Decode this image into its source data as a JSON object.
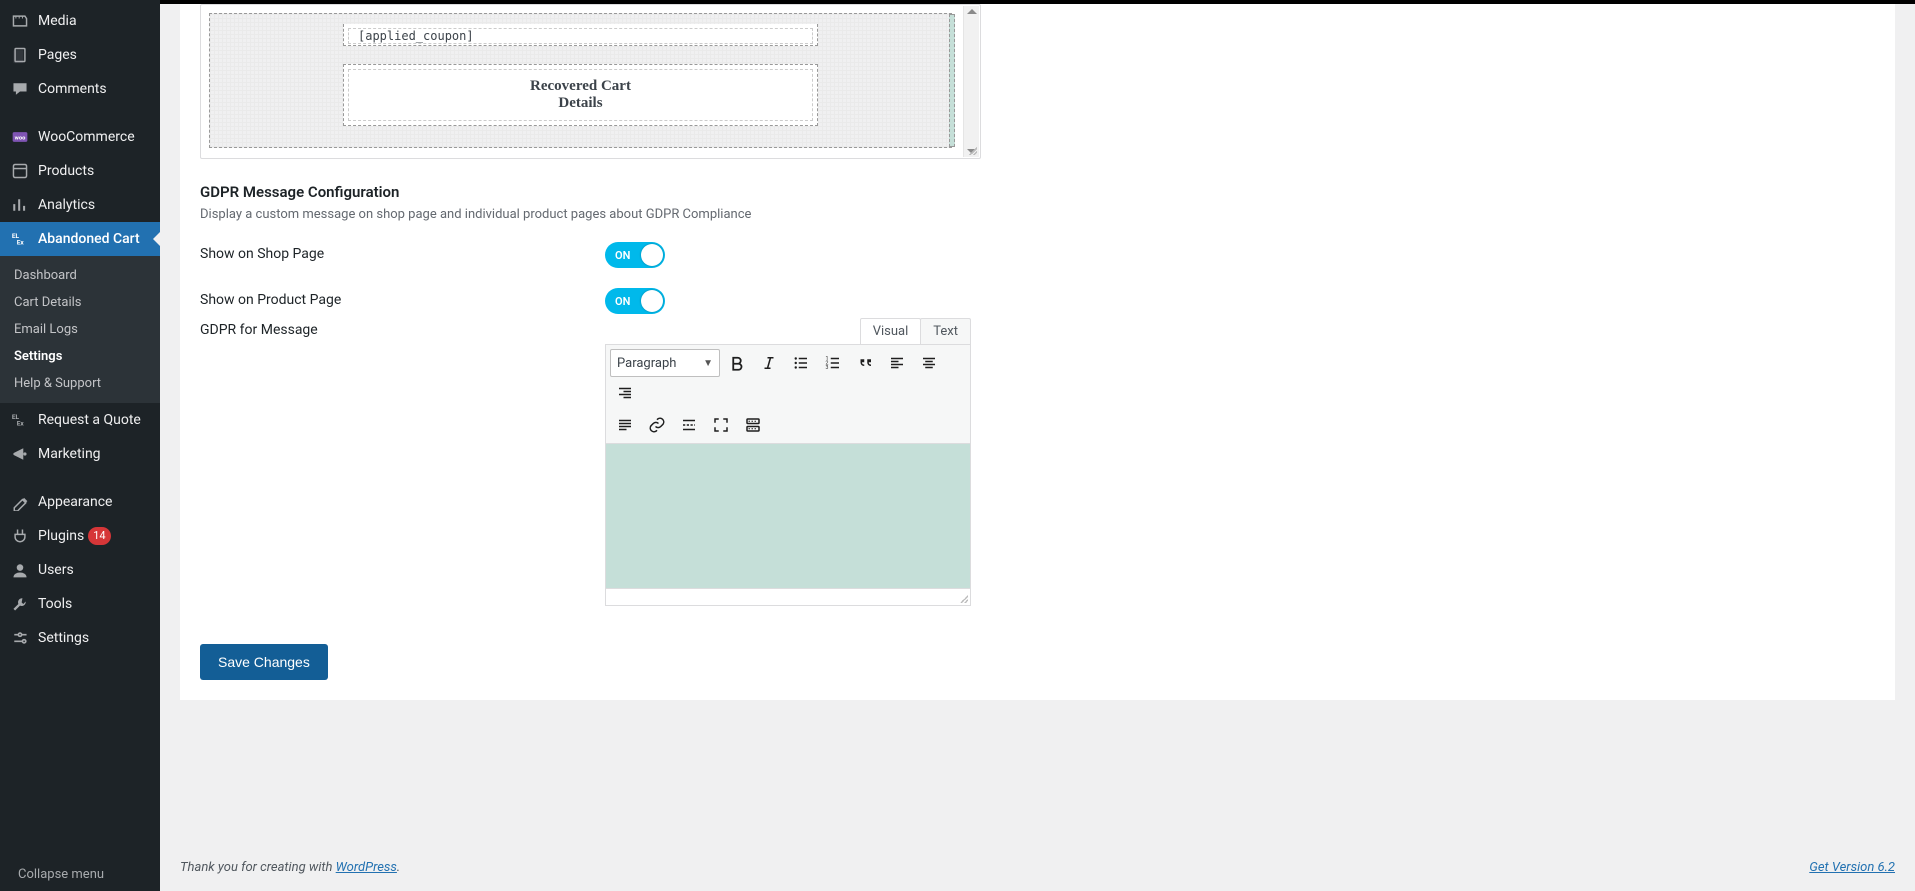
{
  "sidebar": {
    "items": [
      {
        "id": "media",
        "label": "Media",
        "icon": "media"
      },
      {
        "id": "pages",
        "label": "Pages",
        "icon": "pages"
      },
      {
        "id": "comments",
        "label": "Comments",
        "icon": "comments"
      },
      {
        "id": "sep",
        "separator": true
      },
      {
        "id": "woocommerce",
        "label": "WooCommerce",
        "icon": "woo"
      },
      {
        "id": "products",
        "label": "Products",
        "icon": "products"
      },
      {
        "id": "analytics",
        "label": "Analytics",
        "icon": "analytics"
      },
      {
        "id": "abandoned",
        "label": "Abandoned Cart",
        "icon": "elex",
        "active": true
      },
      {
        "id": "quote",
        "label": "Request a Quote",
        "icon": "elex"
      },
      {
        "id": "marketing",
        "label": "Marketing",
        "icon": "marketing"
      },
      {
        "id": "sep2",
        "separator": true
      },
      {
        "id": "appearance",
        "label": "Appearance",
        "icon": "appearance"
      },
      {
        "id": "plugins",
        "label": "Plugins",
        "icon": "plugins",
        "badge": "14"
      },
      {
        "id": "users",
        "label": "Users",
        "icon": "users"
      },
      {
        "id": "tools",
        "label": "Tools",
        "icon": "tools"
      },
      {
        "id": "settings",
        "label": "Settings",
        "icon": "settings"
      }
    ],
    "submenu": [
      {
        "label": "Dashboard"
      },
      {
        "label": "Cart Details"
      },
      {
        "label": "Email Logs"
      },
      {
        "label": "Settings",
        "current": true
      },
      {
        "label": "Help & Support"
      }
    ],
    "collapse_label": "Collapse menu"
  },
  "template_preview": {
    "placeholder": "[applied_coupon]",
    "box_line1": "Recovered Cart",
    "box_line2": "Details"
  },
  "gdpr": {
    "title": "GDPR Message Configuration",
    "desc": "Display a custom message on shop page and individual product pages about GDPR Compliance",
    "shop_label": "Show on Shop Page",
    "product_label": "Show on Product Page",
    "msg_label": "GDPR for Message",
    "toggle_on_text": "ON"
  },
  "editor": {
    "tabs": {
      "visual": "Visual",
      "text": "Text"
    },
    "paragraph": "Paragraph"
  },
  "actions": {
    "save": "Save Changes"
  },
  "footer": {
    "thank_prefix": "Thank you for creating with ",
    "wp_link": "WordPress",
    "version": "Get Version 6.2"
  }
}
